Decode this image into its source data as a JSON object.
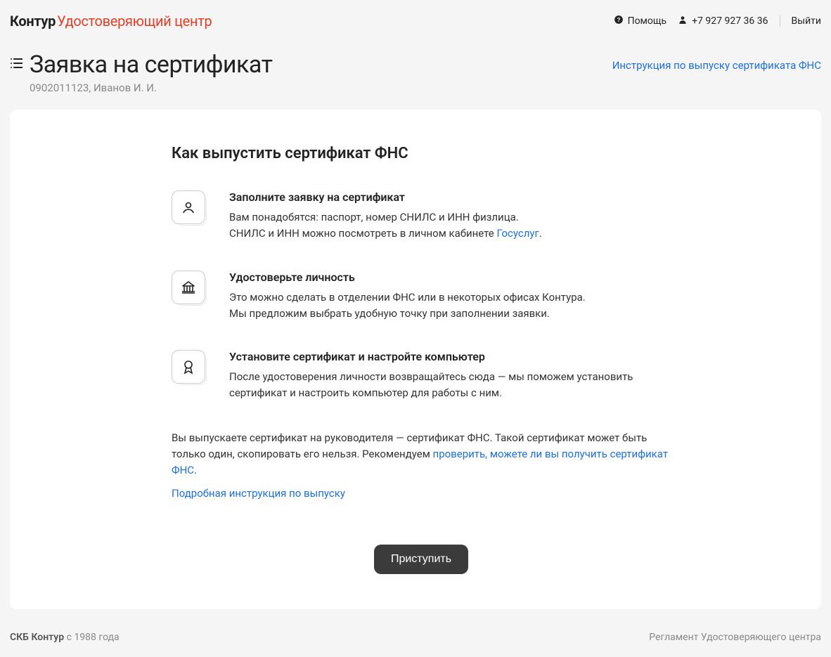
{
  "topbar": {
    "brand": "Контур",
    "sub": "Удостоверяющий центр",
    "help": "Помощь",
    "phone": "+7 927 927 36 36",
    "logout": "Выйти"
  },
  "header": {
    "title": "Заявка на сертификат",
    "subtitle": "0902011123, Иванов И. И.",
    "instruction_link": "Инструкция по выпуску сертификата ФНС"
  },
  "card": {
    "title": "Как выпустить сертификат ФНС",
    "steps": [
      {
        "title": "Заполните заявку на сертификат",
        "line1": "Вам понадобятся: паспорт, номер СНИЛС и ИНН физлица.",
        "line2_prefix": "СНИЛС и ИНН можно посмотреть в личном кабинете ",
        "line2_link": "Госуслуг",
        "line2_suffix": "."
      },
      {
        "title": "Удостоверьте личность",
        "line1": "Это можно сделать в отделении ФНС или в некоторых офисах Контура.",
        "line2": "Мы предложим выбрать удобную точку при заполнении заявки."
      },
      {
        "title": "Установите сертификат и настройте компьютер",
        "line1": "После удостоверения личности возвращайтесь сюда — мы поможем установить сертификат и настроить компьютер для работы с ним."
      }
    ],
    "note_prefix": "Вы выпускаете сертификат на руководителя — сертификат ФНС. Такой сертификат может быть только один, скопировать его нельзя. Рекомендуем ",
    "note_link": "проверить, можете ли вы получить сертификат ФНС",
    "note_suffix": ".",
    "detail_link": "Подробная инструкция по выпуску",
    "cta": "Приступить"
  },
  "footer": {
    "brand": "СКБ Контур",
    "since": " с 1988 года",
    "right": "Регламент Удостоверяющего центра"
  }
}
